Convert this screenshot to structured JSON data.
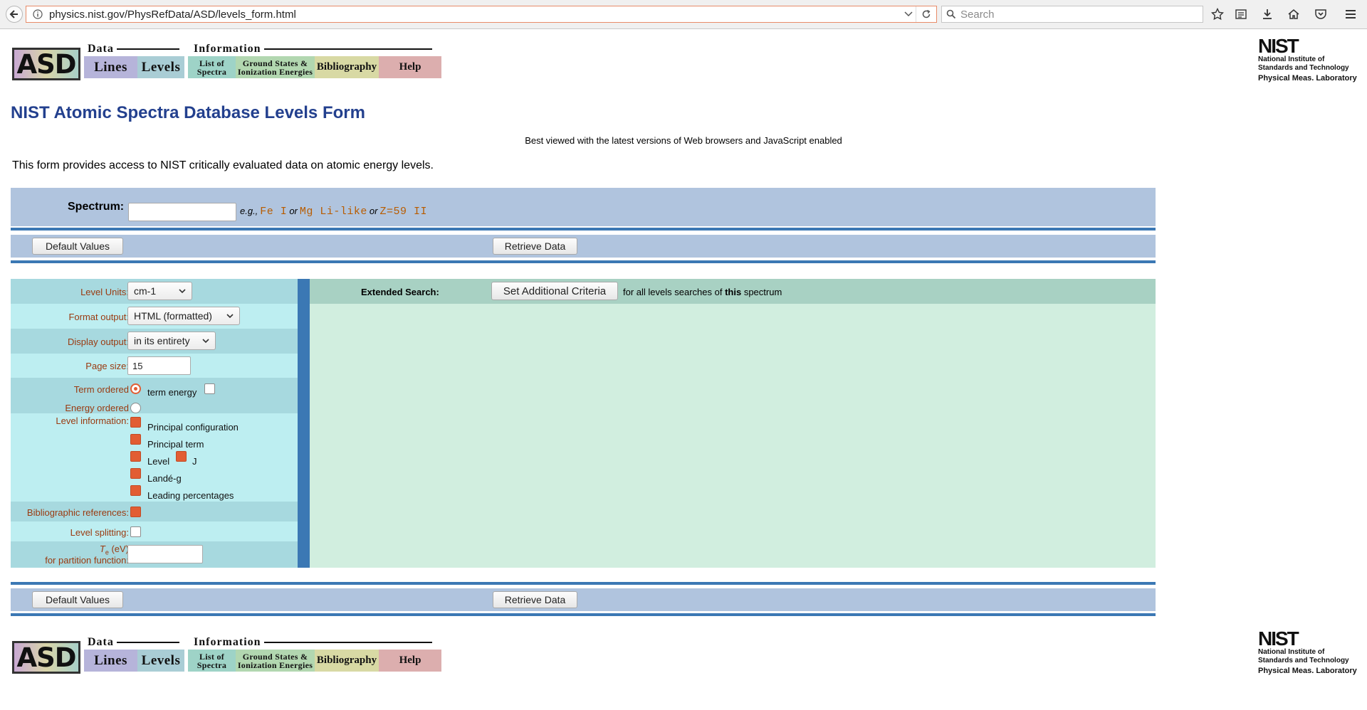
{
  "browser": {
    "url": "physics.nist.gov/PhysRefData/ASD/levels_form.html",
    "search_placeholder": "Search"
  },
  "nav": {
    "logo": "ASD",
    "data_heading": "Data",
    "info_heading": "Information",
    "lines": "Lines",
    "levels": "Levels",
    "list_of_spectra_1": "List of",
    "list_of_spectra_2": "Spectra",
    "ground_states_1": "Ground States &",
    "ground_states_2": "Ionization Energies",
    "bibliography": "Bibliography",
    "help": "Help"
  },
  "nist_logo": {
    "mark": "NIST",
    "line1": "National Institute of",
    "line2": "Standards and Technology",
    "lab": "Physical Meas. Laboratory"
  },
  "page": {
    "title": "NIST Atomic Spectra Database Levels Form",
    "best_viewed": "Best viewed with the latest versions of Web browsers and JavaScript enabled",
    "intro": "This form provides access to NIST critically evaluated data on atomic energy levels."
  },
  "spectrum": {
    "label": "Spectrum:",
    "value": "",
    "eg": "e.g.,",
    "example1": "Fe I",
    "or1": "or",
    "example2": "Mg Li-like",
    "or2": "or",
    "example3": "Z=59 II"
  },
  "buttons": {
    "default_values": "Default Values",
    "retrieve_data": "Retrieve Data",
    "set_additional_criteria": "Set Additional Criteria"
  },
  "options": {
    "level_units_label": "Level Units:",
    "level_units_value": "cm-1",
    "format_output_label": "Format output:",
    "format_output_value": "HTML (formatted)",
    "display_output_label": "Display output:",
    "display_output_value": "in its entirety",
    "page_size_label": "Page size:",
    "page_size_value": "15",
    "term_ordered_label": "Term ordered",
    "term_energy_label": "term energy",
    "energy_ordered_label": "Energy ordered",
    "level_information_label": "Level information:",
    "principal_configuration": "Principal configuration",
    "principal_term": "Principal term",
    "level": "Level",
    "j": "J",
    "lande_g": "Landé-g",
    "leading_percentages": "Leading percentages",
    "bibliographic_references_label": "Bibliographic references:",
    "level_splitting_label": "Level splitting:",
    "te_label_main": "T",
    "te_label_sub": "e",
    "te_label_unit": " (eV)",
    "partition_label": "for partition function:",
    "te_value": ""
  },
  "extended": {
    "label": "Extended Search:",
    "tail_pre": "for all levels searches of ",
    "tail_bold": "this",
    "tail_post": " spectrum"
  },
  "colors": {
    "title_blue": "#23408e",
    "band_blue": "#b0c4de",
    "rule_blue": "#3b78b4",
    "label_brown": "#9a3a10",
    "check_orange": "#e25d33",
    "example_orange": "#b85c00"
  }
}
